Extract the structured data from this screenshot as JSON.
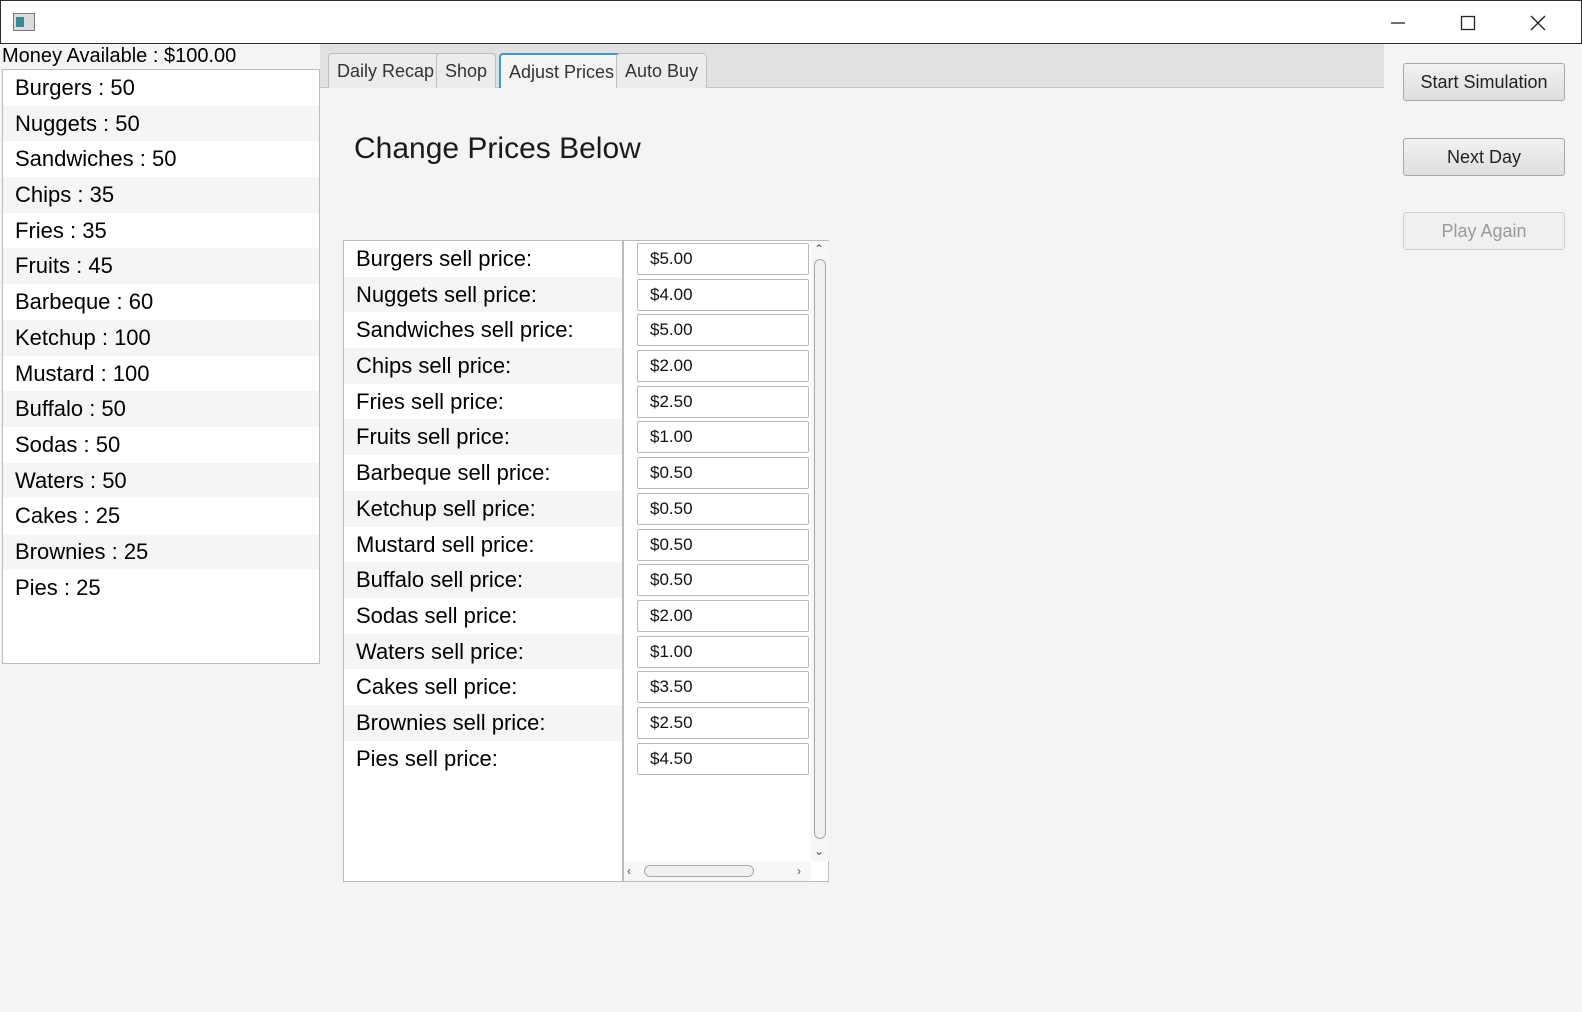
{
  "money": {
    "label": "Money Available : $100.00"
  },
  "inventory": [
    "Burgers : 50",
    "Nuggets : 50",
    "Sandwiches : 50",
    "Chips : 35",
    "Fries : 35",
    "Fruits : 45",
    "Barbeque : 60",
    "Ketchup : 100",
    "Mustard : 100",
    "Buffalo : 50",
    "Sodas : 50",
    "Waters : 50",
    "Cakes : 25",
    "Brownies : 25",
    "Pies : 25"
  ],
  "tabs": [
    {
      "label": "Daily Recap",
      "active": false
    },
    {
      "label": "Shop",
      "active": false
    },
    {
      "label": "Adjust Prices",
      "active": true
    },
    {
      "label": "Auto Buy",
      "active": false
    }
  ],
  "heading": "Change Prices Below",
  "price_labels": [
    "Burgers sell price:",
    "Nuggets sell price:",
    "Sandwiches sell price:",
    "Chips sell price:",
    "Fries sell price:",
    "Fruits sell price:",
    "Barbeque sell price:",
    "Ketchup sell price:",
    "Mustard sell price:",
    "Buffalo sell price:",
    "Sodas sell price:",
    "Waters sell price:",
    "Cakes sell price:",
    "Brownies sell price:",
    "Pies sell price:"
  ],
  "price_values": [
    "$5.00",
    "$4.00",
    "$5.00",
    "$2.00",
    "$2.50",
    "$1.00",
    "$0.50",
    "$0.50",
    "$0.50",
    "$0.50",
    "$2.00",
    "$1.00",
    "$3.50",
    "$2.50",
    "$4.50"
  ],
  "buttons": {
    "start": "Start Simulation",
    "next": "Next Day",
    "play_again": "Play Again"
  }
}
